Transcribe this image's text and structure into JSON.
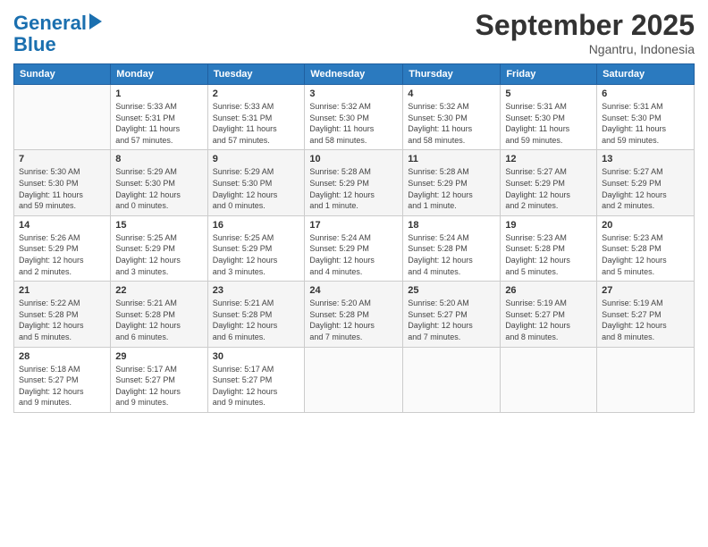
{
  "logo": {
    "line1": "General",
    "line2": "Blue"
  },
  "header": {
    "month": "September 2025",
    "location": "Ngantru, Indonesia"
  },
  "weekdays": [
    "Sunday",
    "Monday",
    "Tuesday",
    "Wednesday",
    "Thursday",
    "Friday",
    "Saturday"
  ],
  "weeks": [
    [
      {
        "day": "",
        "info": ""
      },
      {
        "day": "1",
        "info": "Sunrise: 5:33 AM\nSunset: 5:31 PM\nDaylight: 11 hours\nand 57 minutes."
      },
      {
        "day": "2",
        "info": "Sunrise: 5:33 AM\nSunset: 5:31 PM\nDaylight: 11 hours\nand 57 minutes."
      },
      {
        "day": "3",
        "info": "Sunrise: 5:32 AM\nSunset: 5:30 PM\nDaylight: 11 hours\nand 58 minutes."
      },
      {
        "day": "4",
        "info": "Sunrise: 5:32 AM\nSunset: 5:30 PM\nDaylight: 11 hours\nand 58 minutes."
      },
      {
        "day": "5",
        "info": "Sunrise: 5:31 AM\nSunset: 5:30 PM\nDaylight: 11 hours\nand 59 minutes."
      },
      {
        "day": "6",
        "info": "Sunrise: 5:31 AM\nSunset: 5:30 PM\nDaylight: 11 hours\nand 59 minutes."
      }
    ],
    [
      {
        "day": "7",
        "info": "Sunrise: 5:30 AM\nSunset: 5:30 PM\nDaylight: 11 hours\nand 59 minutes."
      },
      {
        "day": "8",
        "info": "Sunrise: 5:29 AM\nSunset: 5:30 PM\nDaylight: 12 hours\nand 0 minutes."
      },
      {
        "day": "9",
        "info": "Sunrise: 5:29 AM\nSunset: 5:30 PM\nDaylight: 12 hours\nand 0 minutes."
      },
      {
        "day": "10",
        "info": "Sunrise: 5:28 AM\nSunset: 5:29 PM\nDaylight: 12 hours\nand 1 minute."
      },
      {
        "day": "11",
        "info": "Sunrise: 5:28 AM\nSunset: 5:29 PM\nDaylight: 12 hours\nand 1 minute."
      },
      {
        "day": "12",
        "info": "Sunrise: 5:27 AM\nSunset: 5:29 PM\nDaylight: 12 hours\nand 2 minutes."
      },
      {
        "day": "13",
        "info": "Sunrise: 5:27 AM\nSunset: 5:29 PM\nDaylight: 12 hours\nand 2 minutes."
      }
    ],
    [
      {
        "day": "14",
        "info": "Sunrise: 5:26 AM\nSunset: 5:29 PM\nDaylight: 12 hours\nand 2 minutes."
      },
      {
        "day": "15",
        "info": "Sunrise: 5:25 AM\nSunset: 5:29 PM\nDaylight: 12 hours\nand 3 minutes."
      },
      {
        "day": "16",
        "info": "Sunrise: 5:25 AM\nSunset: 5:29 PM\nDaylight: 12 hours\nand 3 minutes."
      },
      {
        "day": "17",
        "info": "Sunrise: 5:24 AM\nSunset: 5:29 PM\nDaylight: 12 hours\nand 4 minutes."
      },
      {
        "day": "18",
        "info": "Sunrise: 5:24 AM\nSunset: 5:28 PM\nDaylight: 12 hours\nand 4 minutes."
      },
      {
        "day": "19",
        "info": "Sunrise: 5:23 AM\nSunset: 5:28 PM\nDaylight: 12 hours\nand 5 minutes."
      },
      {
        "day": "20",
        "info": "Sunrise: 5:23 AM\nSunset: 5:28 PM\nDaylight: 12 hours\nand 5 minutes."
      }
    ],
    [
      {
        "day": "21",
        "info": "Sunrise: 5:22 AM\nSunset: 5:28 PM\nDaylight: 12 hours\nand 5 minutes."
      },
      {
        "day": "22",
        "info": "Sunrise: 5:21 AM\nSunset: 5:28 PM\nDaylight: 12 hours\nand 6 minutes."
      },
      {
        "day": "23",
        "info": "Sunrise: 5:21 AM\nSunset: 5:28 PM\nDaylight: 12 hours\nand 6 minutes."
      },
      {
        "day": "24",
        "info": "Sunrise: 5:20 AM\nSunset: 5:28 PM\nDaylight: 12 hours\nand 7 minutes."
      },
      {
        "day": "25",
        "info": "Sunrise: 5:20 AM\nSunset: 5:27 PM\nDaylight: 12 hours\nand 7 minutes."
      },
      {
        "day": "26",
        "info": "Sunrise: 5:19 AM\nSunset: 5:27 PM\nDaylight: 12 hours\nand 8 minutes."
      },
      {
        "day": "27",
        "info": "Sunrise: 5:19 AM\nSunset: 5:27 PM\nDaylight: 12 hours\nand 8 minutes."
      }
    ],
    [
      {
        "day": "28",
        "info": "Sunrise: 5:18 AM\nSunset: 5:27 PM\nDaylight: 12 hours\nand 9 minutes."
      },
      {
        "day": "29",
        "info": "Sunrise: 5:17 AM\nSunset: 5:27 PM\nDaylight: 12 hours\nand 9 minutes."
      },
      {
        "day": "30",
        "info": "Sunrise: 5:17 AM\nSunset: 5:27 PM\nDaylight: 12 hours\nand 9 minutes."
      },
      {
        "day": "",
        "info": ""
      },
      {
        "day": "",
        "info": ""
      },
      {
        "day": "",
        "info": ""
      },
      {
        "day": "",
        "info": ""
      }
    ]
  ]
}
